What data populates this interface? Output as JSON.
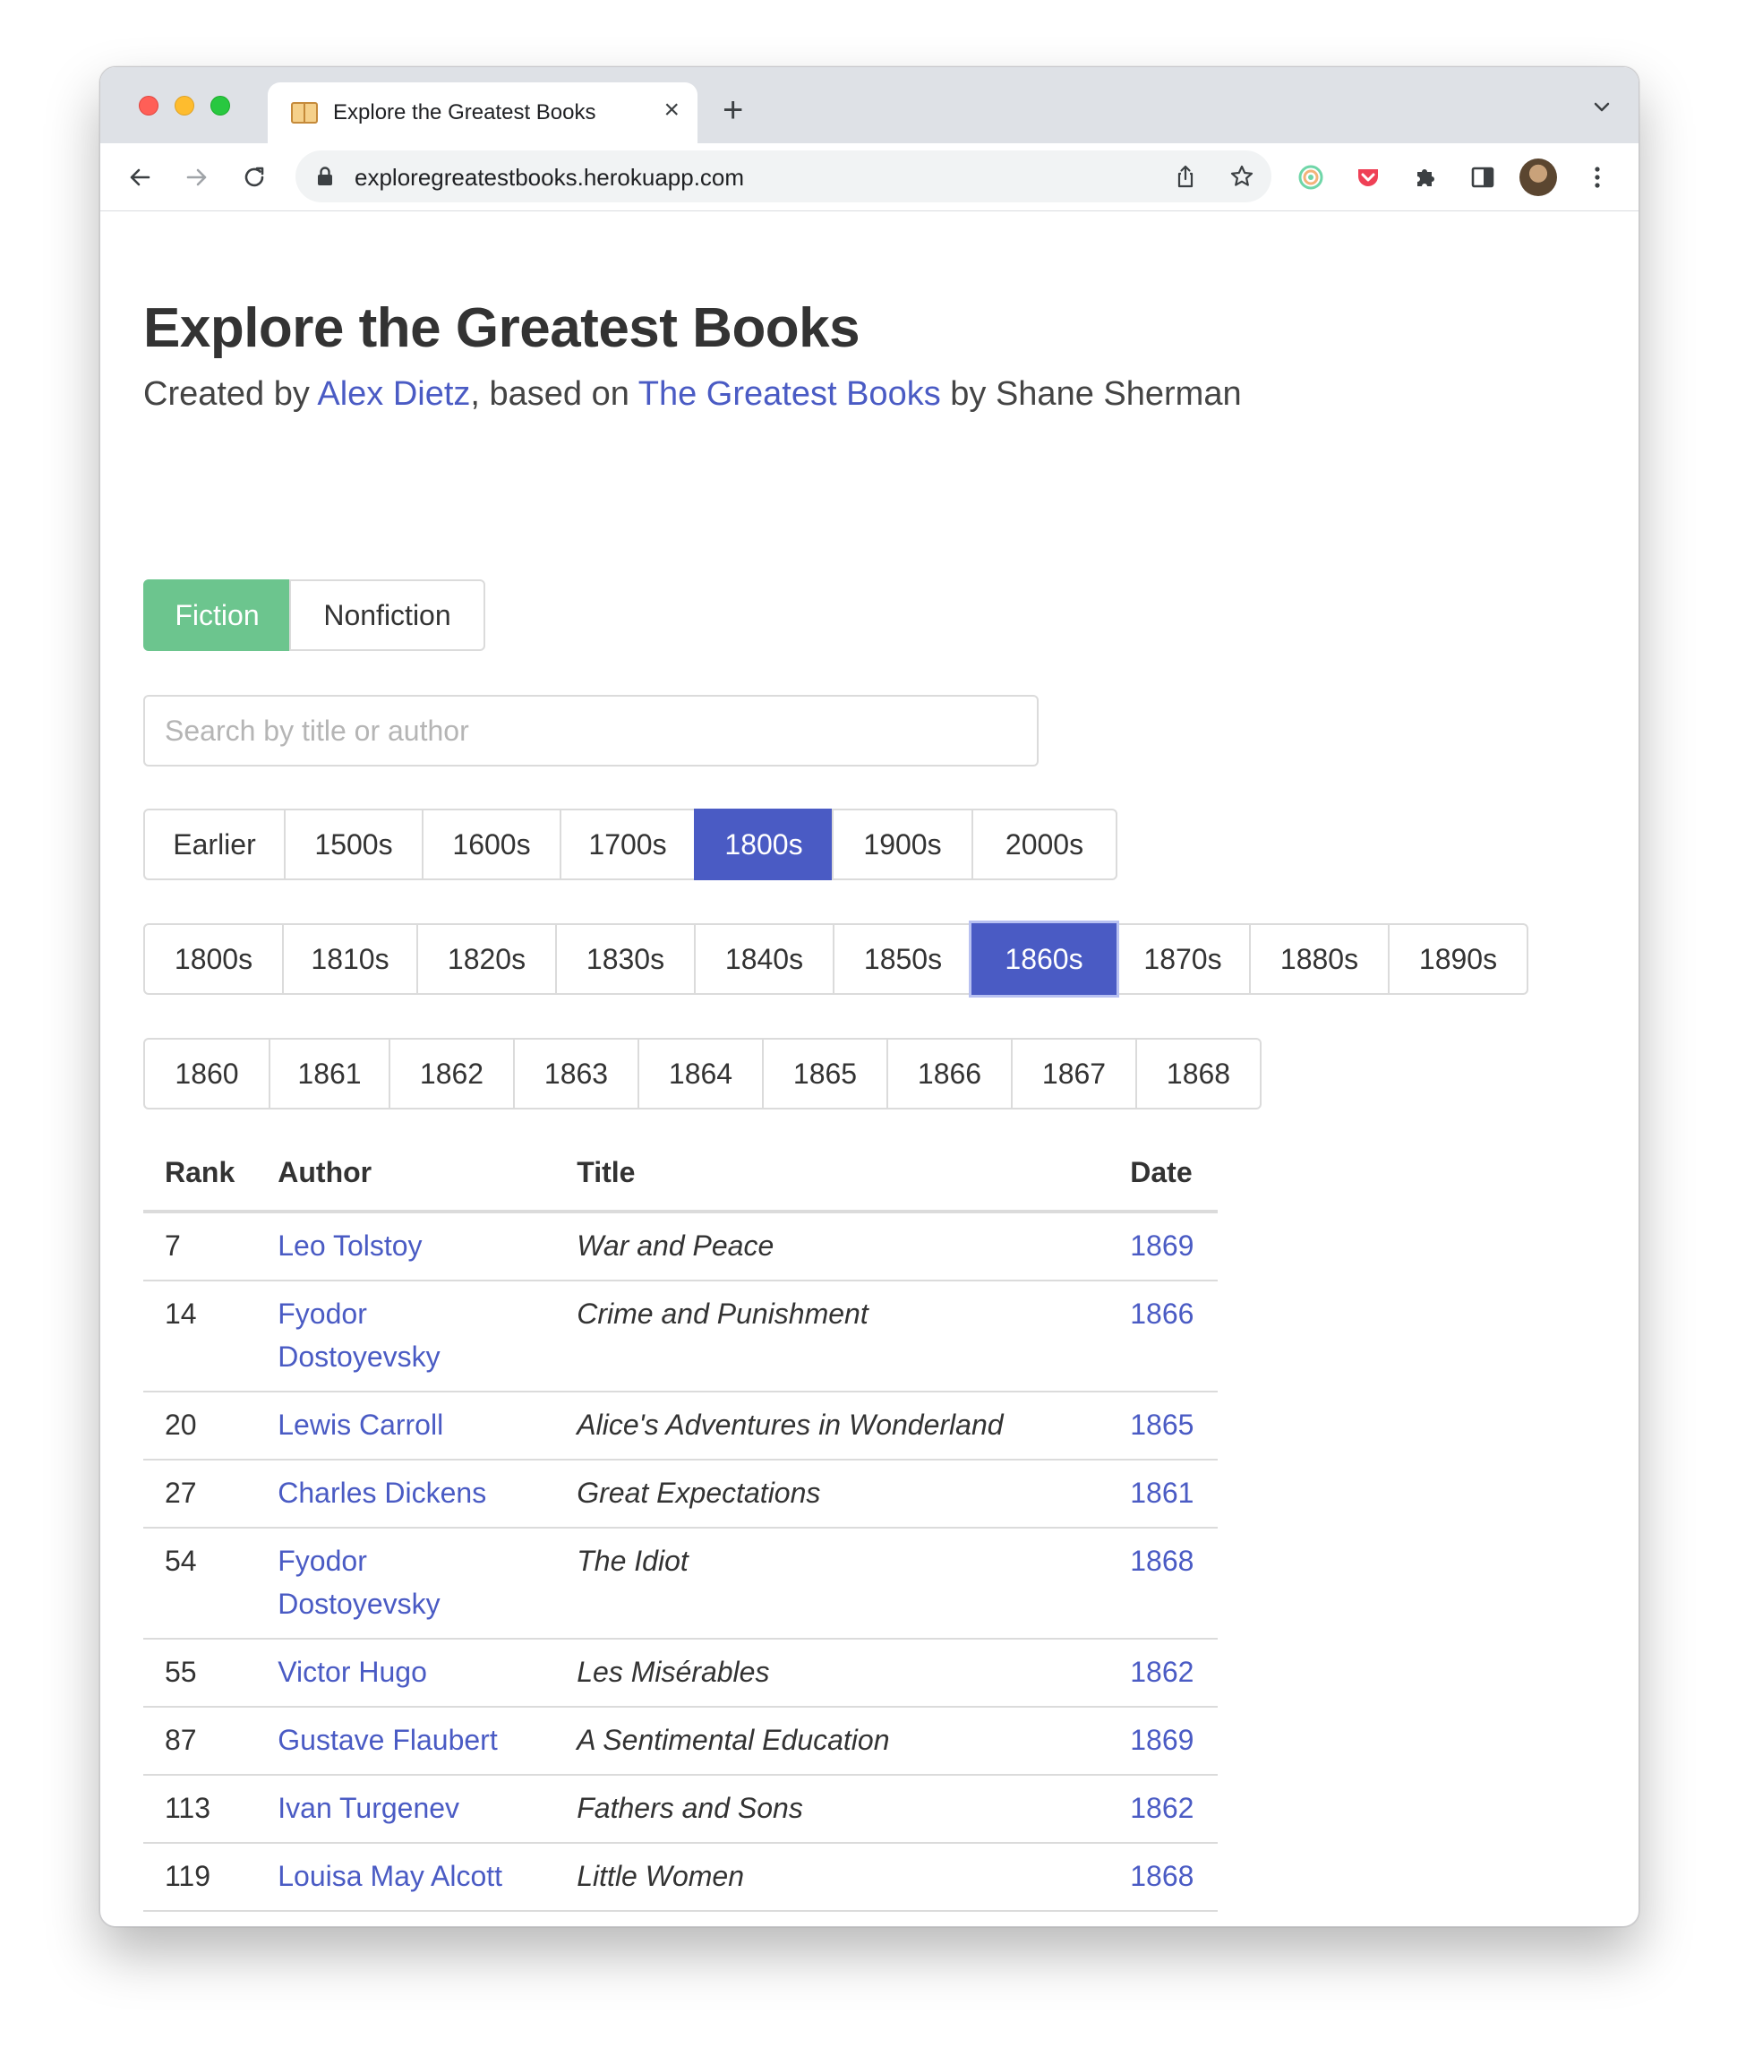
{
  "browser": {
    "tab_title": "Explore the Greatest Books",
    "tab_close": "×",
    "new_tab": "+",
    "url": "exploregreatestbooks.herokuapp.com"
  },
  "header": {
    "title": "Explore the Greatest Books",
    "created_by": "Created by ",
    "author_link": "Alex Dietz",
    "based_on": ", based on ",
    "source_link": "The Greatest Books",
    "by": " by Shane Sherman"
  },
  "genre": {
    "fiction": "Fiction",
    "nonfiction": "Nonfiction",
    "selected": "Fiction"
  },
  "search": {
    "placeholder": "Search by title or author",
    "value": ""
  },
  "centuries": {
    "items": [
      "Earlier",
      "1500s",
      "1600s",
      "1700s",
      "1800s",
      "1900s",
      "2000s"
    ],
    "selected": "1800s"
  },
  "decades": {
    "items": [
      "1800s",
      "1810s",
      "1820s",
      "1830s",
      "1840s",
      "1850s",
      "1860s",
      "1870s",
      "1880s",
      "1890s"
    ],
    "selected": "1860s"
  },
  "years": {
    "items": [
      "1860",
      "1861",
      "1862",
      "1863",
      "1864",
      "1865",
      "1866",
      "1867",
      "1868"
    ],
    "selected": ""
  },
  "table": {
    "headers": {
      "rank": "Rank",
      "author": "Author",
      "title": "Title",
      "date": "Date"
    },
    "rows": [
      {
        "rank": "7",
        "author": "Leo Tolstoy",
        "title": "War and Peace",
        "date": "1869"
      },
      {
        "rank": "14",
        "author": "Fyodor Dostoyevsky",
        "title": "Crime and Punishment",
        "date": "1866"
      },
      {
        "rank": "20",
        "author": "Lewis Carroll",
        "title": "Alice's Adventures in Wonderland",
        "date": "1865"
      },
      {
        "rank": "27",
        "author": "Charles Dickens",
        "title": "Great Expectations",
        "date": "1861"
      },
      {
        "rank": "54",
        "author": "Fyodor Dostoyevsky",
        "title": "The Idiot",
        "date": "1868"
      },
      {
        "rank": "55",
        "author": "Victor Hugo",
        "title": "Les Misérables",
        "date": "1862"
      },
      {
        "rank": "87",
        "author": "Gustave Flaubert",
        "title": "A Sentimental Education",
        "date": "1869"
      },
      {
        "rank": "113",
        "author": "Ivan Turgenev",
        "title": "Fathers and Sons",
        "date": "1862"
      },
      {
        "rank": "119",
        "author": "Louisa May Alcott",
        "title": "Little Women",
        "date": "1868"
      }
    ]
  },
  "colors": {
    "link": "#4a5bc4",
    "selected_button": "#4a5bc4",
    "fiction_button": "#6cc58e"
  }
}
